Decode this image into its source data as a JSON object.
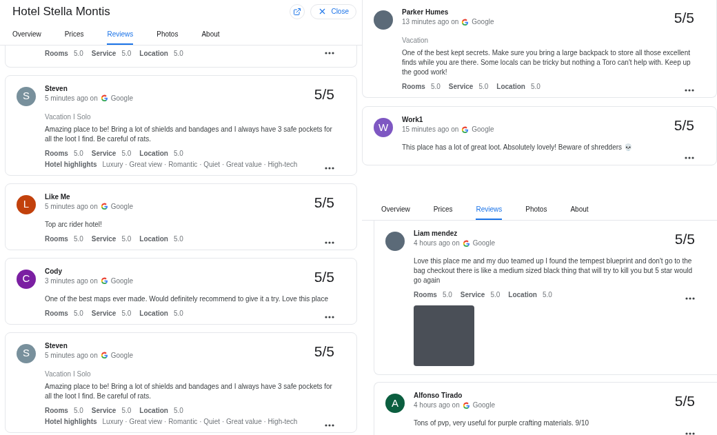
{
  "left": {
    "title": "Hotel Stella Montis",
    "open_button": true,
    "close_button": {
      "label": "Close"
    },
    "tabs": [
      {
        "label": "Overview",
        "selected": false
      },
      {
        "label": "Prices",
        "selected": false
      },
      {
        "label": "Reviews",
        "selected": true
      },
      {
        "label": "Photos",
        "selected": false
      },
      {
        "label": "About",
        "selected": false
      }
    ],
    "reviews": [
      {
        "partial": true,
        "ratings": [
          {
            "label": "Rooms",
            "value": "5.0"
          },
          {
            "label": "Service",
            "value": "5.0"
          },
          {
            "label": "Location",
            "value": "5.0"
          }
        ]
      },
      {
        "avatar": {
          "kind": "letter",
          "letter": "S",
          "color": "#78909c"
        },
        "name": "Steven",
        "time": "5 minutes ago on",
        "source": "Google",
        "score": "5/5",
        "trip": "Vacation I Solo",
        "text": "Amazing place to be! Bring a lot of shields and bandages and I always have 3 safe pockets for all the loot I find. Be careful of rats.",
        "ratings": [
          {
            "label": "Rooms",
            "value": "5.0"
          },
          {
            "label": "Service",
            "value": "5.0"
          },
          {
            "label": "Location",
            "value": "5.0"
          }
        ],
        "highlights": {
          "label": "Hotel highlights",
          "items": "Luxury · Great view · Romantic · Quiet · Great value · High-tech"
        }
      },
      {
        "avatar": {
          "kind": "letter",
          "letter": "L",
          "color": "#c2410c"
        },
        "name": "Like Me",
        "time": "5 minutes ago on",
        "source": "Google",
        "score": "5/5",
        "text": "Top arc rider hotel!",
        "ratings": [
          {
            "label": "Rooms",
            "value": "5.0"
          },
          {
            "label": "Service",
            "value": "5.0"
          },
          {
            "label": "Location",
            "value": "5.0"
          }
        ]
      },
      {
        "avatar": {
          "kind": "letter",
          "letter": "C",
          "color": "#7b1fa2"
        },
        "name": "Cody",
        "time": "3 minutes ago on",
        "source": "Google",
        "score": "5/5",
        "text": "One of the best maps ever made. Would definitely recommend to give it a try. Love this place",
        "ratings": [
          {
            "label": "Rooms",
            "value": "5.0"
          },
          {
            "label": "Service",
            "value": "5.0"
          },
          {
            "label": "Location",
            "value": "5.0"
          }
        ]
      },
      {
        "avatar": {
          "kind": "letter",
          "letter": "S",
          "color": "#78909c"
        },
        "name": "Steven",
        "time": "5 minutes ago on",
        "source": "Google",
        "score": "5/5",
        "trip": "Vacation I Solo",
        "text": "Amazing place to be! Bring a lot of shields and bandages and I always have 3 safe pockets for all the loot I find. Be careful of rats.",
        "ratings": [
          {
            "label": "Rooms",
            "value": "5.0"
          },
          {
            "label": "Service",
            "value": "5.0"
          },
          {
            "label": "Location",
            "value": "5.0"
          }
        ],
        "highlights": {
          "label": "Hotel highlights",
          "items": "Luxury · Great view · Romantic · Quiet · Great value · High-tech"
        }
      }
    ]
  },
  "right_top": {
    "reviews": [
      {
        "avatar": {
          "kind": "photo"
        },
        "name": "Parker Humes",
        "time": "13 minutes ago on",
        "source": "Google",
        "score": "5/5",
        "trip": "Vacation",
        "text": "One of the best kept secrets. Make sure you bring a large backpack to store all those excellent finds while you are there. Some locals can be tricky but nothing a Toro can't help with. Keep up the good work!",
        "ratings": [
          {
            "label": "Rooms",
            "value": "5.0"
          },
          {
            "label": "Service",
            "value": "5.0"
          },
          {
            "label": "Location",
            "value": "5.0"
          }
        ]
      },
      {
        "avatar": {
          "kind": "letter",
          "letter": "W",
          "color": "#7e57c2"
        },
        "name": "Work1",
        "time": "15 minutes ago on",
        "source": "Google",
        "score": "5/5",
        "text": "This place has a lot of great loot. Absolutely lovely! Beware of shredders 💀"
      }
    ]
  },
  "right_bottom": {
    "tabs": [
      {
        "label": "Overview",
        "selected": false
      },
      {
        "label": "Prices",
        "selected": false
      },
      {
        "label": "Reviews",
        "selected": true
      },
      {
        "label": "Photos",
        "selected": false
      },
      {
        "label": "About",
        "selected": false
      }
    ],
    "reviews": [
      {
        "avatar": {
          "kind": "photo"
        },
        "name": "Liam mendez",
        "time": "4 hours ago on",
        "source": "Google",
        "score": "5/5",
        "text": "Love this place me and my duo teamed up I found the tempest blueprint and don't go to the bag checkout there is like a medium sized black thing that will try to kill you but 5 star would go again",
        "ratings": [
          {
            "label": "Rooms",
            "value": "5.0"
          },
          {
            "label": "Service",
            "value": "5.0"
          },
          {
            "label": "Location",
            "value": "5.0"
          }
        ],
        "photo": true
      },
      {
        "avatar": {
          "kind": "letter",
          "letter": "A",
          "color": "#0b5e3f"
        },
        "name": "Alfonso Tirado",
        "time": "4 hours ago on",
        "source": "Google",
        "score": "5/5",
        "text": "Tons of pvp, very useful for purple crafting materials. 9/10"
      }
    ]
  }
}
